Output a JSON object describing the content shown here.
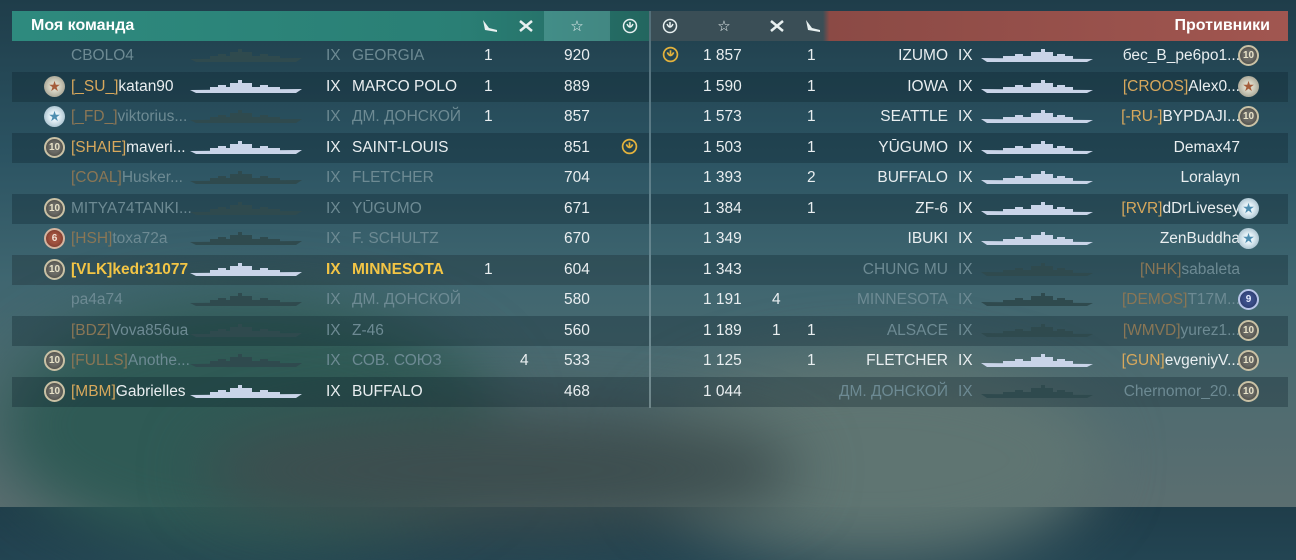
{
  "left": {
    "title": "Моя команда",
    "headers": {
      "planes_icon": "planes-killed",
      "ships_icon": "ships-killed",
      "xp_icon": "☆",
      "achievement_icon": "achievement"
    },
    "rows": [
      {
        "badge": "",
        "clan": "",
        "player": "CBOLO4",
        "tier": "IX",
        "ship": "GEORGIA",
        "planes": "1",
        "kills": "",
        "xp": "920",
        "medal": "",
        "dim": true
      },
      {
        "badge": "star",
        "clan": "[_SU_]",
        "player": "katan90",
        "tier": "IX",
        "ship": "MARCO POLO",
        "planes": "1",
        "kills": "",
        "xp": "889",
        "medal": "",
        "dim": false
      },
      {
        "badge": "star-blue",
        "clan": "[_FD_]",
        "player": "viktorius...",
        "tier": "IX",
        "ship": "ДМ. ДОНСКОЙ",
        "planes": "1",
        "kills": "",
        "xp": "857",
        "medal": "",
        "dim": true
      },
      {
        "badge": "10",
        "clan": "[SHAIE]",
        "player": "maveri...",
        "tier": "IX",
        "ship": "SAINT-LOUIS",
        "planes": "",
        "kills": "",
        "xp": "851",
        "medal": "yes",
        "dim": false
      },
      {
        "badge": "",
        "clan": "[COAL]",
        "player": "Husker...",
        "tier": "IX",
        "ship": "FLETCHER",
        "planes": "",
        "kills": "",
        "xp": "704",
        "medal": "",
        "dim": true
      },
      {
        "badge": "10",
        "clan": "",
        "player": "MITYA74TANKI...",
        "tier": "IX",
        "ship": "YŪGUMO",
        "planes": "",
        "kills": "",
        "xp": "671",
        "medal": "",
        "dim": true
      },
      {
        "badge": "6",
        "clan": "[HSH]",
        "player": "toxa72a",
        "tier": "IX",
        "ship": "F. SCHULTZ",
        "planes": "",
        "kills": "",
        "xp": "670",
        "medal": "",
        "dim": true
      },
      {
        "badge": "10",
        "clan": "[VLK]",
        "player": "kedr31077",
        "tier": "IX",
        "ship": "MINNESOTA",
        "planes": "1",
        "kills": "",
        "xp": "604",
        "medal": "",
        "dim": false,
        "self": true
      },
      {
        "badge": "",
        "clan": "",
        "player": "pa4a74",
        "tier": "IX",
        "ship": "ДМ. ДОНСКОЙ",
        "planes": "",
        "kills": "",
        "xp": "580",
        "medal": "",
        "dim": true
      },
      {
        "badge": "",
        "clan": "[BDZ]",
        "player": "Vova856ua",
        "tier": "IX",
        "ship": "Z-46",
        "planes": "",
        "kills": "",
        "xp": "560",
        "medal": "",
        "dim": true
      },
      {
        "badge": "10",
        "clan": "[FULLS]",
        "player": "Anothe...",
        "tier": "IX",
        "ship": "СОВ. СОЮЗ",
        "planes": "",
        "kills": "4",
        "xp": "533",
        "medal": "",
        "dim": true
      },
      {
        "badge": "10",
        "clan": "[MBM]",
        "player": "Gabrielles",
        "tier": "IX",
        "ship": "BUFFALO",
        "planes": "",
        "kills": "",
        "xp": "468",
        "medal": "",
        "dim": false
      }
    ]
  },
  "right": {
    "title": "Противники",
    "rows": [
      {
        "medal": "yes",
        "xp": "1 857",
        "kills": "",
        "planes": "1",
        "ship": "IZUMO",
        "tier": "IX",
        "clan": "",
        "player": "бес_В_ре6ро1...",
        "badge": "10",
        "dim": false
      },
      {
        "medal": "",
        "xp": "1 590",
        "kills": "",
        "planes": "1",
        "ship": "IOWA",
        "tier": "IX",
        "clan": "[CROOS]",
        "player": "Alex0...",
        "badge": "star",
        "dim": false
      },
      {
        "medal": "",
        "xp": "1 573",
        "kills": "",
        "planes": "1",
        "ship": "SEATTLE",
        "tier": "IX",
        "clan": "[-RU-]",
        "player": "BYPDAJI...",
        "badge": "10",
        "dim": false
      },
      {
        "medal": "",
        "xp": "1 503",
        "kills": "",
        "planes": "1",
        "ship": "YŪGUMO",
        "tier": "IX",
        "clan": "",
        "player": "Demax47",
        "badge": "",
        "dim": false
      },
      {
        "medal": "",
        "xp": "1 393",
        "kills": "",
        "planes": "2",
        "ship": "BUFFALO",
        "tier": "IX",
        "clan": "",
        "player": "Loralayn",
        "badge": "",
        "dim": false
      },
      {
        "medal": "",
        "xp": "1 384",
        "kills": "",
        "planes": "1",
        "ship": "ZF-6",
        "tier": "IX",
        "clan": "[RVR]",
        "player": "dDrLivesey",
        "badge": "star-blue",
        "dim": false
      },
      {
        "medal": "",
        "xp": "1 349",
        "kills": "",
        "planes": "",
        "ship": "IBUKI",
        "tier": "IX",
        "clan": "",
        "player": "ZenBuddha",
        "badge": "star-blue",
        "dim": false
      },
      {
        "medal": "",
        "xp": "1 343",
        "kills": "",
        "planes": "",
        "ship": "CHUNG MU",
        "tier": "IX",
        "clan": "[NHK]",
        "player": "sabaleta",
        "badge": "",
        "dim": true
      },
      {
        "medal": "",
        "xp": "1 191",
        "kills": "4",
        "planes": "",
        "ship": "MINNESOTA",
        "tier": "IX",
        "clan": "[DEMOS]",
        "player": "T17M...",
        "badge": "9",
        "dim": true
      },
      {
        "medal": "",
        "xp": "1 189",
        "kills": "1",
        "planes": "1",
        "ship": "ALSACE",
        "tier": "IX",
        "clan": "[WMVD]",
        "player": "yurez1...",
        "badge": "10",
        "dim": true
      },
      {
        "medal": "",
        "xp": "1 125",
        "kills": "",
        "planes": "1",
        "ship": "FLETCHER",
        "tier": "IX",
        "clan": "[GUN]",
        "player": "evgeniyV...",
        "badge": "10",
        "dim": false
      },
      {
        "medal": "",
        "xp": "1 044",
        "kills": "",
        "planes": "",
        "ship": "ДМ. ДОНСКОЙ",
        "tier": "IX",
        "clan": "",
        "player": "Chernomor_20...",
        "badge": "10",
        "dim": true
      }
    ]
  }
}
